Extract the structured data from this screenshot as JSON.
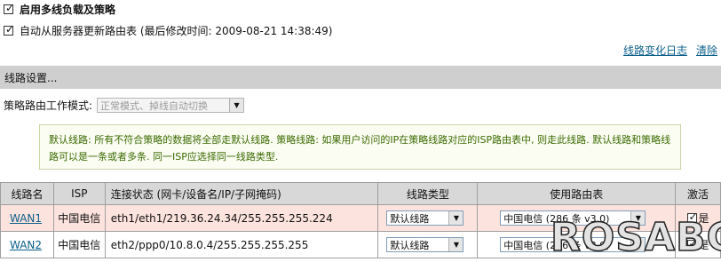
{
  "options": {
    "enable_multiline": {
      "label": "启用多线负载及策略",
      "checked": true
    },
    "auto_update": {
      "label": "自动从服务器更新路由表 (最后修改时间: 2009-08-21 14:38:49)",
      "checked": true
    }
  },
  "links": {
    "line_change_log": "线路变化日志",
    "clear": "清除"
  },
  "section": {
    "title": "线路设置..."
  },
  "policy_mode": {
    "label": "策略路由工作模式:",
    "value": "正常模式、掉线自动切换"
  },
  "note": {
    "text": "默认线路: 所有不符合策略的数据将全部走默认线路. 策略线路: 如果用户访问的IP在策略线路对应的ISP路由表中, 则走此线路. 默认线路和策略线路可以是一条或者多条. 同一ISP应选择同一线路类型."
  },
  "table": {
    "headers": [
      "线路名",
      "ISP",
      "连接状态 (网卡/设备名/IP/子网掩码)",
      "线路类型",
      "使用路由表",
      "激活"
    ],
    "rows": [
      {
        "name": "WAN1",
        "isp": "中国电信",
        "status": "eth1/eth1/219.36.24.34/255.255.255.224",
        "line_type": "默认线路",
        "route_table": "中国电信 (286 条 v3.0)",
        "active_label": "是",
        "active": true
      },
      {
        "name": "WAN2",
        "isp": "中国电信",
        "status": "eth2/ppp0/10.8.0.4/255.255.255.255",
        "line_type": "默认线路",
        "route_table": "中国电信 (286 条 v3.0)",
        "active_label": "是",
        "active": true
      }
    ]
  },
  "watermark": "ROSABC"
}
